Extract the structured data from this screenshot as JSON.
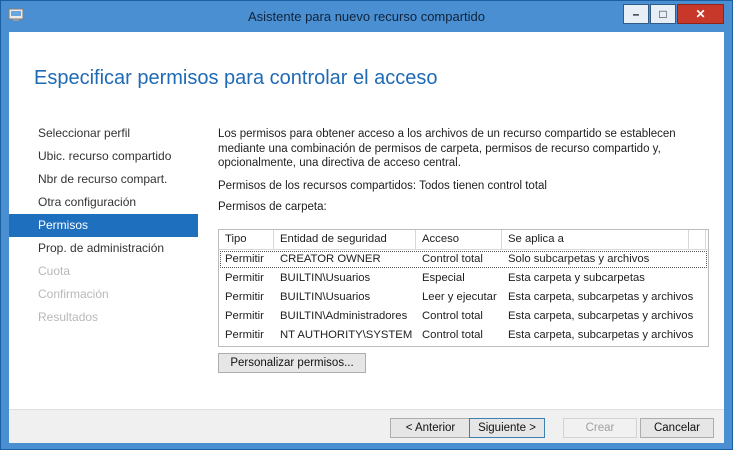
{
  "window": {
    "title": "Asistente para nuevo recurso compartido",
    "controls": {
      "minimize": "–",
      "maximize": "□",
      "close": "✕"
    }
  },
  "page": {
    "heading": "Especificar permisos para controlar el acceso"
  },
  "nav": {
    "items": [
      {
        "label": "Seleccionar perfil",
        "state": "normal"
      },
      {
        "label": "Ubic. recurso compartido",
        "state": "normal"
      },
      {
        "label": "Nbr de recurso compart.",
        "state": "normal"
      },
      {
        "label": "Otra configuración",
        "state": "normal"
      },
      {
        "label": "Permisos",
        "state": "active"
      },
      {
        "label": "Prop. de administración",
        "state": "normal"
      },
      {
        "label": "Cuota",
        "state": "disabled"
      },
      {
        "label": "Confirmación",
        "state": "disabled"
      },
      {
        "label": "Resultados",
        "state": "disabled"
      }
    ]
  },
  "content": {
    "description": "Los permisos para obtener acceso a los archivos de un recurso compartido se establecen mediante una combinación de permisos de carpeta, permisos de recurso compartido y, opcionalmente, una directiva de acceso central.",
    "share_permissions": "Permisos de los recursos compartidos: Todos tienen control total",
    "folder_permissions_label": "Permisos de carpeta:",
    "table": {
      "headers": [
        "Tipo",
        "Entidad de seguridad",
        "Acceso",
        "Se aplica a"
      ],
      "rows": [
        [
          "Permitir",
          "CREATOR OWNER",
          "Control total",
          "Solo subcarpetas y archivos"
        ],
        [
          "Permitir",
          "BUILTIN\\Usuarios",
          "Especial",
          "Esta carpeta y subcarpetas"
        ],
        [
          "Permitir",
          "BUILTIN\\Usuarios",
          "Leer y ejecutar",
          "Esta carpeta, subcarpetas y archivos"
        ],
        [
          "Permitir",
          "BUILTIN\\Administradores",
          "Control total",
          "Esta carpeta, subcarpetas y archivos"
        ],
        [
          "Permitir",
          "NT AUTHORITY\\SYSTEM",
          "Control total",
          "Esta carpeta, subcarpetas y archivos"
        ]
      ]
    },
    "customize_button": "Personalizar permisos..."
  },
  "footer": {
    "previous": "< Anterior",
    "next": "Siguiente >",
    "create": "Crear",
    "cancel": "Cancelar"
  },
  "colors": {
    "accent": "#1f6fbf",
    "heading": "#1f6ab5",
    "titlebar": "#4a8fd1",
    "close": "#c7382a"
  }
}
